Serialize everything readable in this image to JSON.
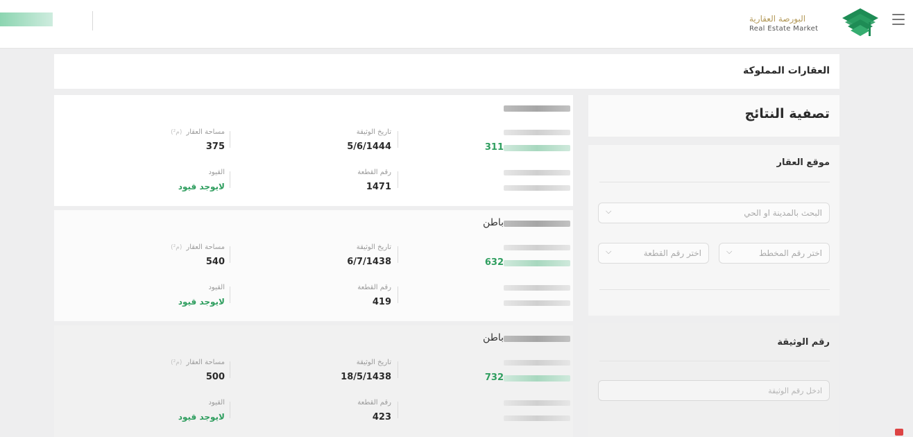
{
  "header": {
    "brand_ar": "البورصة العقارية",
    "brand_en": "Real Estate Market"
  },
  "page": {
    "title": "العقارات المملوكة"
  },
  "filters": {
    "title": "تصفية النتائج",
    "location": {
      "title": "موقع العقار",
      "city_search_placeholder": "البحث بالمدينة او الحي",
      "plan_placeholder": "اختر رقم المخطط",
      "plot_placeholder": "اختر رقم القطعة"
    },
    "deed": {
      "title": "رقم الوثيقة",
      "input_placeholder": "ادخل رقم الوثيقة"
    }
  },
  "labels": {
    "doc_date": "تاريخ الوثيقة",
    "area": "مساحة العقار",
    "area_unit": "(م²)",
    "plot_no": "رقم القطعة",
    "restrictions": "القيود"
  },
  "properties": [
    {
      "name": "",
      "ref": "311",
      "doc_date": "5/6/1444",
      "area": "375",
      "plot_no": "1471",
      "restrictions": "لايوجد قيود"
    },
    {
      "name": "باطن",
      "ref": "632",
      "doc_date": "6/7/1438",
      "area": "540",
      "plot_no": "419",
      "restrictions": "لايوجد قيود"
    },
    {
      "name": "باطن",
      "ref": "732",
      "doc_date": "18/5/1438",
      "area": "500",
      "plot_no": "423",
      "restrictions": "لايوجد قيود"
    }
  ],
  "colors": {
    "accent_green": "#2f9e5f",
    "brand_gold": "#b49a5a",
    "logo_green": "#1e8c55"
  }
}
